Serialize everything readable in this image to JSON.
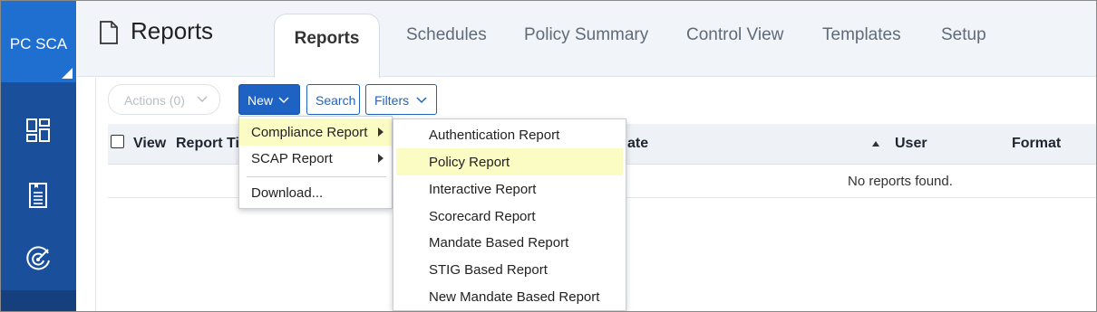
{
  "rail": {
    "brand": "PC SCA",
    "icons": [
      "dashboard-icon",
      "report-list-icon",
      "scan-radar-icon"
    ]
  },
  "header": {
    "title": "Reports",
    "tabs": [
      {
        "label": "Reports",
        "active": true
      },
      {
        "label": "Schedules"
      },
      {
        "label": "Policy Summary"
      },
      {
        "label": "Control View"
      },
      {
        "label": "Templates"
      },
      {
        "label": "Setup"
      }
    ]
  },
  "toolbar": {
    "actions_label": "Actions (0)",
    "new_label": "New",
    "search_label": "Search",
    "filters_label": "Filters"
  },
  "table": {
    "columns": [
      "View",
      "Report Ti",
      "ate",
      "User",
      "Format"
    ],
    "empty_message": "No reports found."
  },
  "new_menu": {
    "items": [
      {
        "label": "Compliance Report",
        "submenu": true,
        "highlighted": true
      },
      {
        "label": "SCAP Report",
        "submenu": true
      },
      {
        "label": "Download..."
      }
    ]
  },
  "compliance_submenu": {
    "items": [
      {
        "label": "Authentication Report"
      },
      {
        "label": "Policy Report",
        "highlighted": true
      },
      {
        "label": "Interactive Report"
      },
      {
        "label": "Scorecard Report"
      },
      {
        "label": "Mandate Based Report"
      },
      {
        "label": "STIG Based Report"
      },
      {
        "label": "New Mandate Based Report"
      }
    ]
  },
  "colors": {
    "brand_blue": "#1e6fd0",
    "rail_blue": "#1a4f9c",
    "primary_button": "#1e63c4",
    "highlight": "#fbfbc4"
  }
}
